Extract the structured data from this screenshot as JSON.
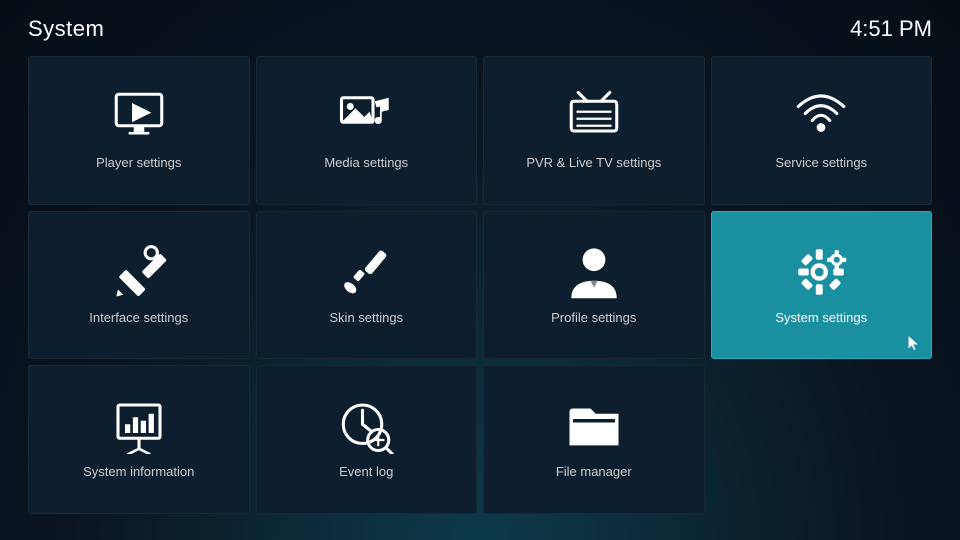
{
  "header": {
    "title": "System",
    "time": "4:51 PM"
  },
  "tiles": [
    {
      "id": "player-settings",
      "label": "Player settings",
      "icon": "player",
      "active": false,
      "row": 1,
      "col": 1
    },
    {
      "id": "media-settings",
      "label": "Media settings",
      "icon": "media",
      "active": false,
      "row": 1,
      "col": 2
    },
    {
      "id": "pvr-settings",
      "label": "PVR & Live TV settings",
      "icon": "pvr",
      "active": false,
      "row": 1,
      "col": 3
    },
    {
      "id": "service-settings",
      "label": "Service settings",
      "icon": "service",
      "active": false,
      "row": 1,
      "col": 4
    },
    {
      "id": "interface-settings",
      "label": "Interface settings",
      "icon": "interface",
      "active": false,
      "row": 2,
      "col": 1
    },
    {
      "id": "skin-settings",
      "label": "Skin settings",
      "icon": "skin",
      "active": false,
      "row": 2,
      "col": 2
    },
    {
      "id": "profile-settings",
      "label": "Profile settings",
      "icon": "profile",
      "active": false,
      "row": 2,
      "col": 3
    },
    {
      "id": "system-settings",
      "label": "System settings",
      "icon": "system",
      "active": true,
      "row": 2,
      "col": 4
    },
    {
      "id": "system-information",
      "label": "System information",
      "icon": "sysinfo",
      "active": false,
      "row": 3,
      "col": 1
    },
    {
      "id": "event-log",
      "label": "Event log",
      "icon": "eventlog",
      "active": false,
      "row": 3,
      "col": 2
    },
    {
      "id": "file-manager",
      "label": "File manager",
      "icon": "filemanager",
      "active": false,
      "row": 3,
      "col": 3
    }
  ]
}
